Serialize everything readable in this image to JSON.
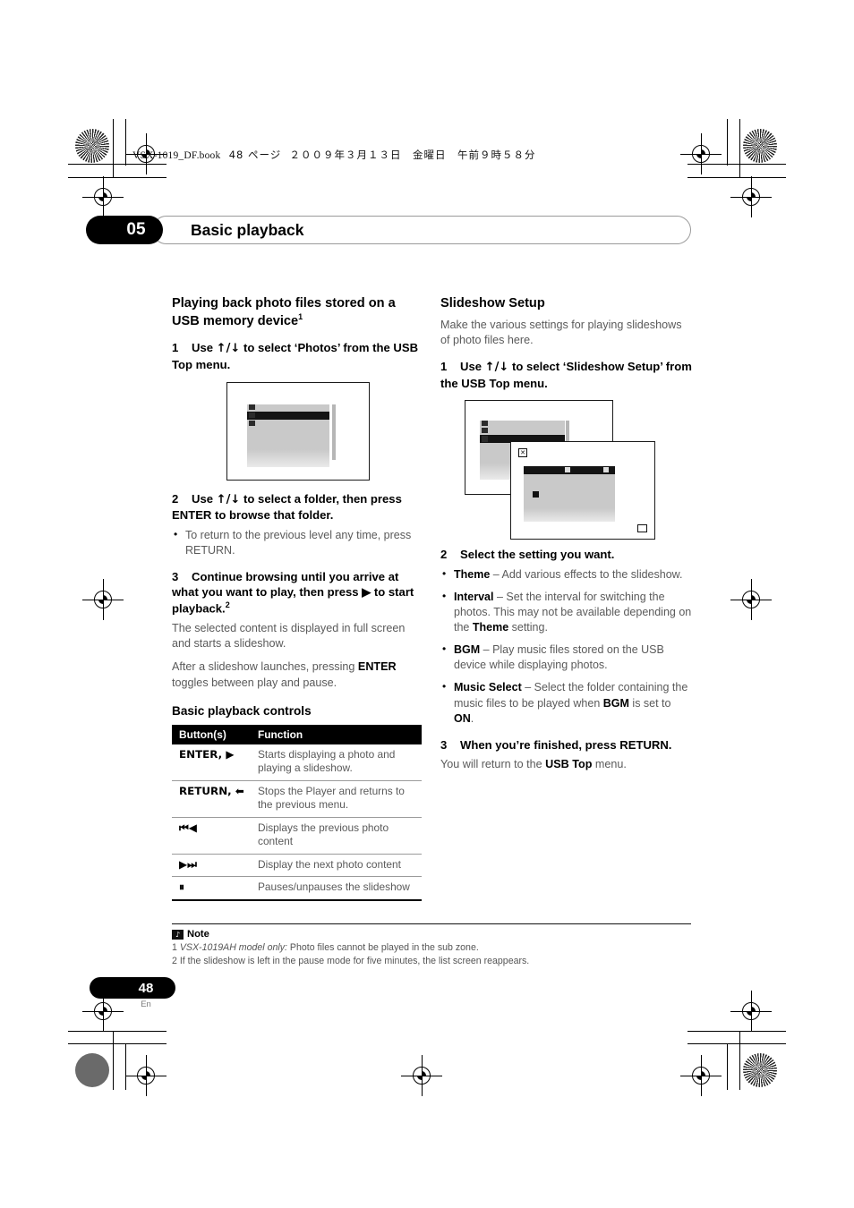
{
  "print": {
    "book_line_prefix": "VSX-1019_DF.book",
    "book_line_page": "48 ページ",
    "book_line_date": "２００９年３月１３日　金曜日　午前９時５８分"
  },
  "chapter": {
    "number": "05",
    "title": "Basic playback"
  },
  "left": {
    "heading": "Playing back photo files stored on a USB memory device",
    "heading_sup": "1",
    "step1": {
      "n": "1",
      "text_a": "Use ",
      "arrows": "↑/↓",
      "text_b": " to select ‘Photos’ from the USB Top menu."
    },
    "step2": {
      "n": "2",
      "text_a": "Use ",
      "arrows": "↑/↓",
      "text_b": " to select a folder, then press ENTER to browse that folder.",
      "bullet": "To return to the previous level any time, press RETURN."
    },
    "step3": {
      "n": "3",
      "text": "Continue browsing until you arrive at what you want to play, then press ▶ to start playback.",
      "sup": "2"
    },
    "para1": "The selected content is displayed in full screen and starts a slideshow.",
    "para2_a": "After a slideshow launches, pressing ",
    "para2_b": "ENTER",
    "para2_c": " toggles between play and pause.",
    "controls_heading": "Basic playback controls",
    "table": {
      "headers": [
        "Button(s)",
        "Function"
      ],
      "rows": [
        {
          "button": "ENTER, ▶",
          "function": "Starts displaying a photo and playing a slideshow."
        },
        {
          "button": "RETURN, ⬅",
          "function": "Stops the Player and returns to the previous menu."
        },
        {
          "button": "⏮◀",
          "function": "Displays the previous photo content"
        },
        {
          "button": "▶⏭",
          "function": "Display the next photo content"
        },
        {
          "button": "⏸",
          "function": "Pauses/unpauses the slideshow"
        }
      ]
    }
  },
  "right": {
    "heading": "Slideshow Setup",
    "intro": "Make the various settings for playing slideshows of photo files here.",
    "step1": {
      "n": "1",
      "text_a": "Use ",
      "arrows": "↑/↓",
      "text_b": " to select ‘Slideshow Setup’ from the USB Top menu."
    },
    "step2": {
      "n": "2",
      "text": "Select the setting you want.",
      "bullets": [
        {
          "term": "Theme",
          "rest": " – Add various effects to the slideshow."
        },
        {
          "term": "Interval",
          "rest": " – Set the interval for switching the photos. This may not be available depending on the ",
          "term2": "Theme",
          "rest2": " setting."
        },
        {
          "term": "BGM",
          "rest": " – Play music files stored on the USB device while displaying photos."
        },
        {
          "term": "Music Select",
          "rest": " – Select the folder containing the music files to be played when ",
          "term2": "BGM",
          "rest2": " is set to ",
          "term3": "ON",
          "rest3": "."
        }
      ]
    },
    "step3": {
      "n": "3",
      "text": "When you’re finished, press RETURN.",
      "after_a": "You will return to the ",
      "after_b": "USB Top",
      "after_c": " menu."
    }
  },
  "notes": {
    "icon": "♪",
    "label": "Note",
    "items": [
      {
        "num": "1 ",
        "italic": "VSX-1019AH model only:",
        "rest": " Photo files cannot be played in the sub zone."
      },
      {
        "num": "2 ",
        "italic": "",
        "rest": "If the slideshow is left in the pause mode for five minutes, the list screen reappears."
      }
    ]
  },
  "footer": {
    "page": "48",
    "lang": "En"
  }
}
